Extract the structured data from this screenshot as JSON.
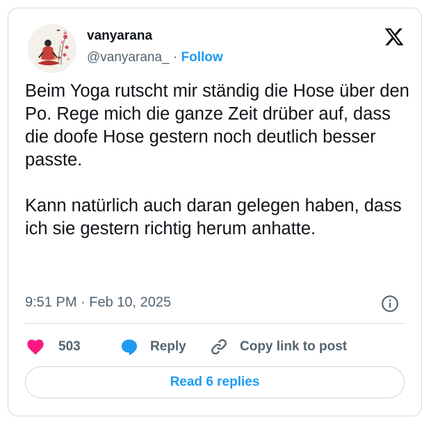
{
  "author": {
    "display_name": "vanyarana",
    "handle": "@vanyarana_",
    "separator": "·",
    "follow_label": "Follow",
    "avatar_icon": "yoga-illustration-avatar"
  },
  "brand": {
    "logo_icon": "x-logo-icon"
  },
  "tweet": {
    "paragraph_1": "Beim Yoga rutscht mir ständig die Hose über den Po. Rege mich die ganze Zeit drüber auf, dass die doofe Hose gestern noch deutlich besser passte.",
    "paragraph_2": "Kann natürlich auch daran gelegen haben, dass ich sie gestern richtig herum anhatte.",
    "timestamp": "9:51 PM · Feb 10, 2025"
  },
  "actions": {
    "likes_count": "503",
    "reply_label": "Reply",
    "copy_link_label": "Copy link to post"
  },
  "read_replies_label": "Read 6 replies",
  "colors": {
    "accent": "#1d9bf0",
    "like": "#f91880",
    "text": "#0f1419",
    "muted": "#536471",
    "border": "#cfd9de"
  }
}
